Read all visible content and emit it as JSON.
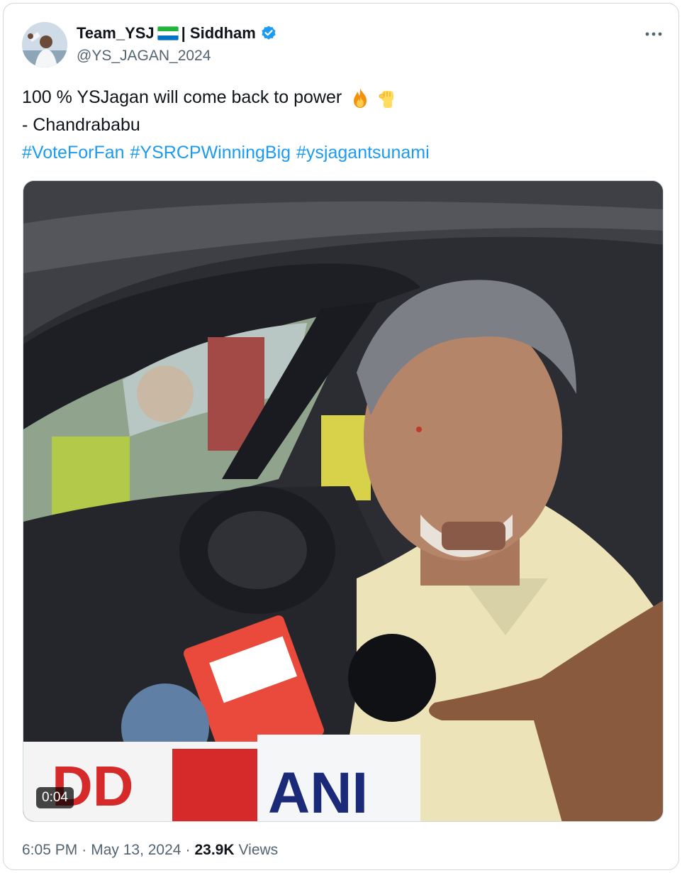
{
  "author": {
    "display_name": "Team_YSJ",
    "display_suffix": "| Siddham",
    "handle": "@YS_JAGAN_2024",
    "flag_icon": "flag-sierra-leone-icon",
    "verified_icon": "verified-badge-icon",
    "verified_color": "#1d9bf0"
  },
  "more_icon": "more-horizontal-icon",
  "tweet": {
    "line1": "100 % YSJagan will come back to power",
    "line1_emojis": [
      "fire-emoji-icon",
      "raised-fist-emoji-icon"
    ],
    "line2": "- Chandrababu",
    "hashtags": [
      "#VoteForFan",
      "#YSRCPWinningBig",
      "#ysjagantsunami"
    ]
  },
  "media": {
    "duration": "0:04",
    "mic_labels": [
      "ANI",
      "DD"
    ]
  },
  "footer": {
    "time": "6:05 PM",
    "sep1": "·",
    "date": "May 13, 2024",
    "sep2": "·",
    "views_count": "23.9K",
    "views_label": "Views"
  },
  "colors": {
    "link": "#1d9bf0",
    "secondary_text": "#536471",
    "border": "#cfd9de"
  }
}
